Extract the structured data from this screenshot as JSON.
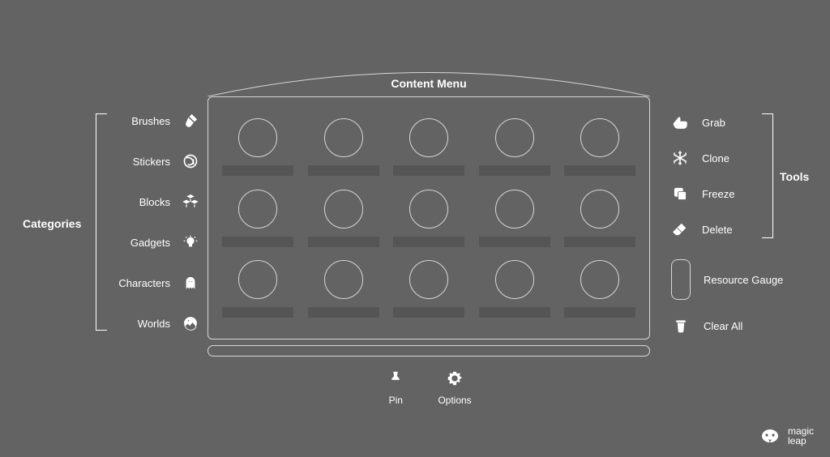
{
  "panel": {
    "title": "Content Menu"
  },
  "sections": {
    "categories_label": "Categories",
    "tools_label": "Tools"
  },
  "categories": [
    {
      "label": "Brushes",
      "icon": "brush-icon"
    },
    {
      "label": "Stickers",
      "icon": "sticker-icon"
    },
    {
      "label": "Blocks",
      "icon": "blocks-icon"
    },
    {
      "label": "Gadgets",
      "icon": "lightbulb-icon"
    },
    {
      "label": "Characters",
      "icon": "ghost-icon"
    },
    {
      "label": "Worlds",
      "icon": "globe-photo-icon"
    }
  ],
  "tools": [
    {
      "label": "Grab",
      "icon": "hand-icon"
    },
    {
      "label": "Clone",
      "icon": "snowflake-icon"
    },
    {
      "label": "Freeze",
      "icon": "copy-icon"
    },
    {
      "label": "Delete",
      "icon": "eraser-icon"
    }
  ],
  "gauge": {
    "label": "Resource Gauge"
  },
  "clear": {
    "label": "Clear All",
    "icon": "trash-icon"
  },
  "bottom": {
    "pin": {
      "label": "Pin",
      "icon": "pin-icon"
    },
    "options": {
      "label": "Options",
      "icon": "gear-icon"
    }
  },
  "brand": {
    "line1": "magic",
    "line2": "leap"
  },
  "grid": {
    "rows": 3,
    "cols": 5
  }
}
